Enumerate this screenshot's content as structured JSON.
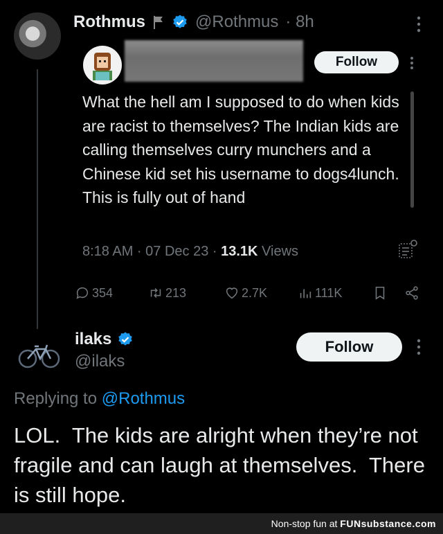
{
  "outer_tweet": {
    "name": "Rothmus",
    "handle": "@Rothmus",
    "time": "· 8h"
  },
  "quoted_tweet": {
    "follow_label": "Follow",
    "text": "What the hell am I supposed to do when kids are racist to themselves? The Indian kids are calling themselves curry munchers and a Chinese kid set his username to dogs4lunch. This is fully out of hand",
    "timestamp": "8:18 AM · 07 Dec 23 · ",
    "views_count": "13.1K",
    "views_label": " Views"
  },
  "stats": {
    "replies": "354",
    "retweets": "213",
    "likes": "2.7K",
    "views": "111K"
  },
  "reply_tweet": {
    "name": "ilaks",
    "handle": "@ilaks",
    "follow_label": "Follow",
    "replying_prefix": "Replying to ",
    "replying_to": "@Rothmus",
    "text": "LOL.  The kids are alright when they’re not fragile and can laugh at themselves.  There is still hope."
  },
  "footer": {
    "prefix": "Non-stop fun at ",
    "brand": "FUNsubstance.com"
  },
  "colors": {
    "background": "#000000",
    "text_primary": "#e7e9ea",
    "text_secondary": "#71767b",
    "accent_blue": "#1d9bf0",
    "follow_bg": "#eff3f4"
  }
}
